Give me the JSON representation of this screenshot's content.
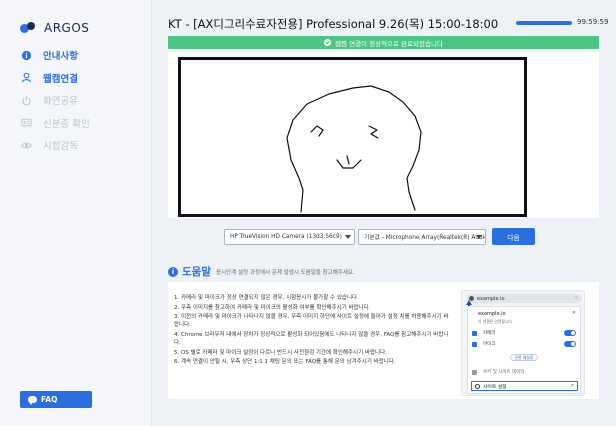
{
  "app": {
    "name": "ARGOS"
  },
  "sidebar": {
    "items": [
      {
        "label": "안내사항",
        "icon": "info-icon",
        "state": "active"
      },
      {
        "label": "웹캠연결",
        "icon": "user-icon",
        "state": "active"
      },
      {
        "label": "화면공유",
        "icon": "power-icon",
        "state": "inactive"
      },
      {
        "label": "신분증 확인",
        "icon": "id-card-icon",
        "state": "inactive"
      },
      {
        "label": "시험감독",
        "icon": "eye-icon",
        "state": "inactive"
      }
    ],
    "faq_label": "FAQ"
  },
  "header": {
    "title": "KT - [AX디그리수료자전용] Professional 9.26(목) 15:00-18:00",
    "timer": "99:59:59",
    "progress": 1.0
  },
  "status": {
    "text": "웹캠 연결이 정상적으로 완료되었습니다"
  },
  "controls": {
    "camera_value": "HP TrueVision HD Camera (13d3:56c9)",
    "mic_value": "기본값 - Microphone Array(Realtek(R) Audio)",
    "next_label": "다음"
  },
  "help": {
    "icon_glyph": "i",
    "title": "도움말",
    "subtitle": "응시단계 설정 과정에서 문제 발생시 도움말을 참고해주세요.",
    "items": [
      "1. 카메라 및 마이크가 정상 연결되지 않은 경우, 시험응시가 불가할 수 있습니다.",
      "2. 우측 이미지를 참고하여 카메라 및 마이크의 활성화 여부를 확인해주시기 바랍니다.",
      "3. 이전의 카메라 및 마이크가 나타나지 않을 경우, 우측 이미지 하단에 사이트 설정에 들어가 설정 치를 허용해주시기 바랍니다.",
      "4. Chrome 브라우저 내에서 장치가 정상적으로 활성화 되어있음에도 나타나지 않을 경우, FAQ를 참고해주시기 바랍니다.",
      "5. OS 별로 카메라 및 마이크 설정이 다르니 반드시 사전점검 기간에 확인해주시기 바랍니다.",
      "6. 계속 연결이 안될 시, 우측 상단 1:1 1 채팅 문의 또는 FAQ를 통해 문의 남겨주시기 바랍니다."
    ],
    "mock": {
      "url": "example.io",
      "domain": "example.io",
      "secure": "이 연결은 안전합니다",
      "camera_label": "카메라",
      "mic_label": "마이크",
      "reset_label": "권한 재설정",
      "cookie_label": "쿠키 및 사이트 데이터",
      "settings_label": "사이트 설정"
    }
  },
  "colors": {
    "accent": "#2b6fde",
    "success": "#4dc486",
    "sidebar_bg": "#f4f6f9"
  }
}
